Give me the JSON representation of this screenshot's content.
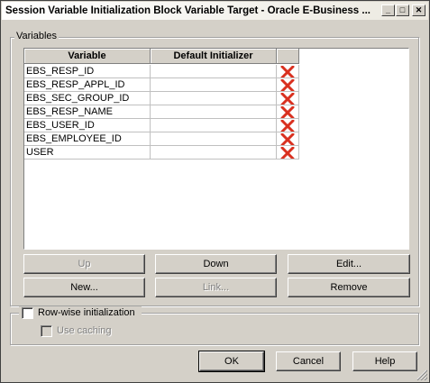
{
  "window": {
    "title": "Session Variable Initialization Block Variable Target - Oracle E-Business ...",
    "minimize": "_",
    "maximize": "□",
    "close": "✕"
  },
  "variables_group": {
    "label": "Variables",
    "columns": [
      "Variable",
      "Default Initializer",
      ""
    ],
    "rows": [
      {
        "variable": "EBS_RESP_ID",
        "initializer": ""
      },
      {
        "variable": "EBS_RESP_APPL_ID",
        "initializer": ""
      },
      {
        "variable": "EBS_SEC_GROUP_ID",
        "initializer": ""
      },
      {
        "variable": "EBS_RESP_NAME",
        "initializer": ""
      },
      {
        "variable": "EBS_USER_ID",
        "initializer": ""
      },
      {
        "variable": "EBS_EMPLOYEE_ID",
        "initializer": ""
      },
      {
        "variable": "USER",
        "initializer": ""
      }
    ],
    "delete_icon_color": "#d9301f",
    "buttons": {
      "up": "Up",
      "down": "Down",
      "edit": "Edit...",
      "new": "New...",
      "link": "Link...",
      "remove": "Remove"
    }
  },
  "row_wise": {
    "label": "Row-wise initialization",
    "checked": false,
    "use_caching": {
      "label": "Use caching",
      "checked": false,
      "enabled": false
    }
  },
  "footer": {
    "ok": "OK",
    "cancel": "Cancel",
    "help": "Help"
  }
}
